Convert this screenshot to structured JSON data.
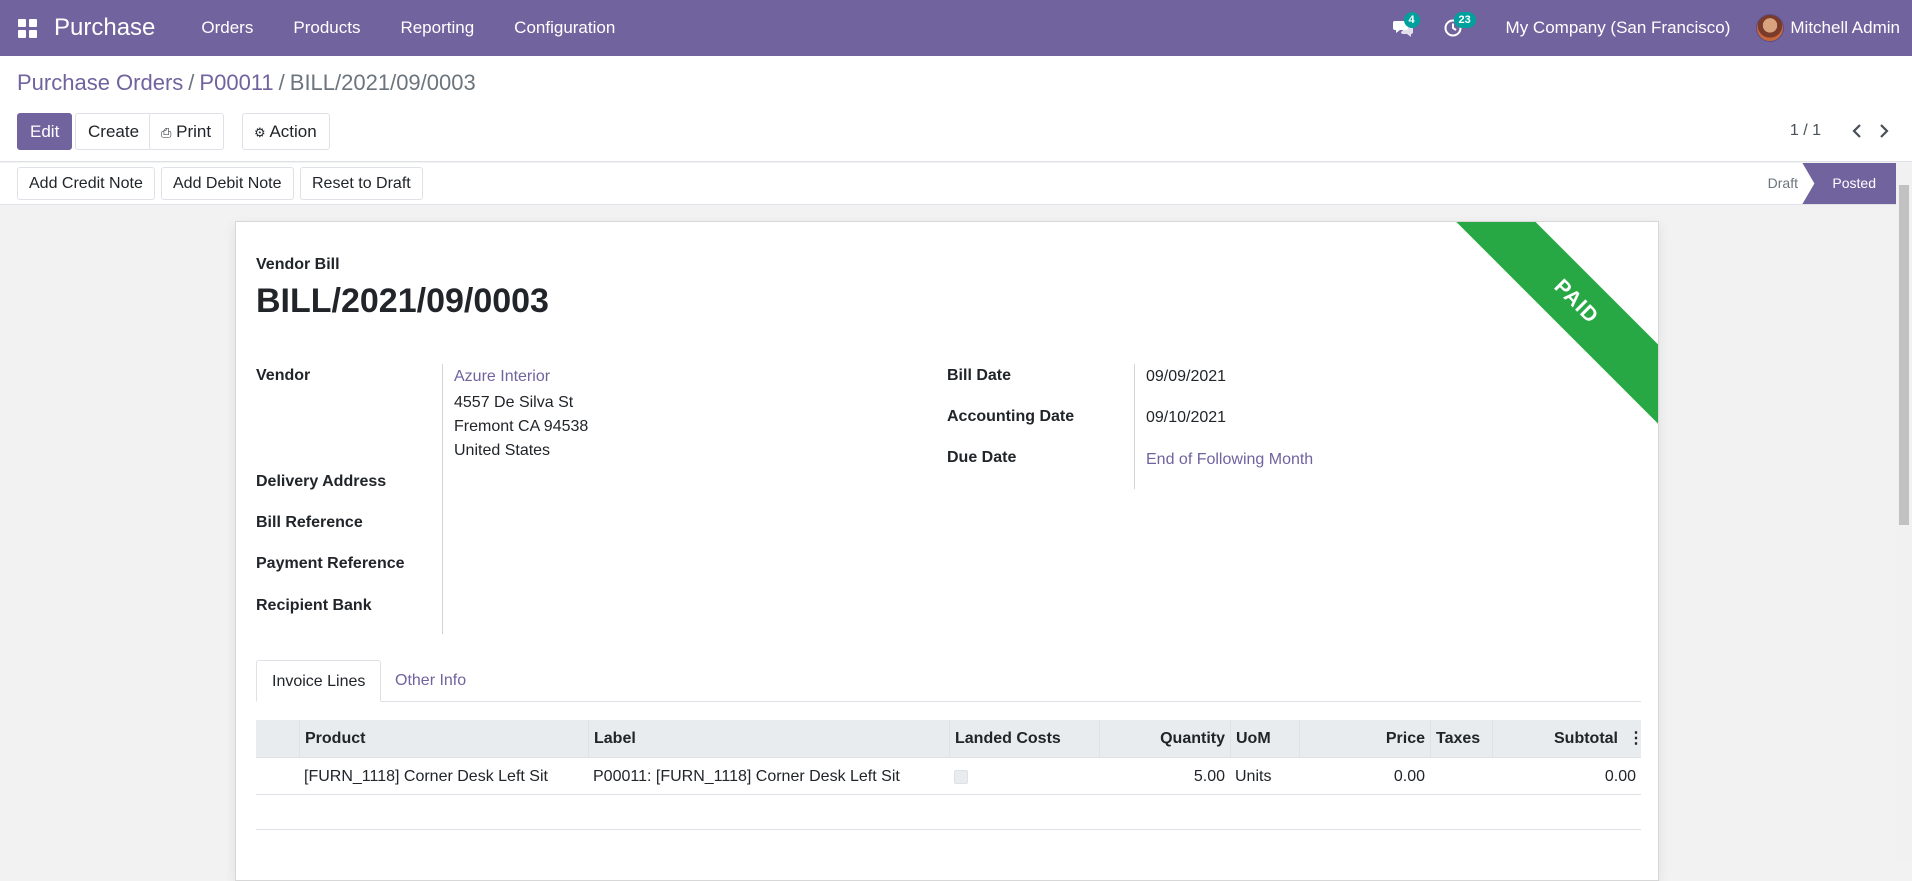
{
  "navbar": {
    "app_name": "Purchase",
    "menu": [
      "Orders",
      "Products",
      "Reporting",
      "Configuration"
    ],
    "messages_count": "4",
    "activities_count": "23",
    "company": "My Company (San Francisco)",
    "user": "Mitchell Admin"
  },
  "breadcrumb": {
    "items": [
      "Purchase Orders",
      "P00011"
    ],
    "current": "BILL/2021/09/0003"
  },
  "buttons": {
    "edit": "Edit",
    "create": "Create",
    "print": "Print",
    "action": "Action"
  },
  "pager": {
    "value": "1 / 1"
  },
  "statusbar": {
    "buttons": [
      "Add Credit Note",
      "Add Debit Note",
      "Reset to Draft"
    ],
    "stages": [
      "Draft",
      "Posted"
    ],
    "current_stage": "Posted"
  },
  "bill": {
    "type": "Vendor Bill",
    "name": "BILL/2021/09/0003",
    "ribbon": "PAID",
    "vendor_label": "Vendor",
    "vendor_name": "Azure Interior",
    "vendor_address": [
      "4557 De Silva St",
      "Fremont CA 94538",
      "United States"
    ],
    "delivery_address_label": "Delivery Address",
    "bill_reference_label": "Bill Reference",
    "payment_reference_label": "Payment Reference",
    "recipient_bank_label": "Recipient Bank",
    "bill_date_label": "Bill Date",
    "bill_date": "09/09/2021",
    "accounting_date_label": "Accounting Date",
    "accounting_date": "09/10/2021",
    "due_date_label": "Due Date",
    "due_date": "End of Following Month"
  },
  "tabs": [
    "Invoice Lines",
    "Other Info"
  ],
  "invoice_lines": {
    "columns": [
      "Product",
      "Label",
      "Landed Costs",
      "Quantity",
      "UoM",
      "Price",
      "Taxes",
      "Subtotal"
    ],
    "rows": [
      {
        "product": "[FURN_1118] Corner Desk Left Sit",
        "label": "P00011: [FURN_1118] Corner Desk Left Sit",
        "landed_costs": false,
        "quantity": "5.00",
        "uom": "Units",
        "price": "0.00",
        "taxes": "",
        "subtotal": "0.00"
      }
    ]
  },
  "colors": {
    "brand": "#71639e",
    "paid_ribbon": "#28a745",
    "badge": "#00a09d"
  }
}
